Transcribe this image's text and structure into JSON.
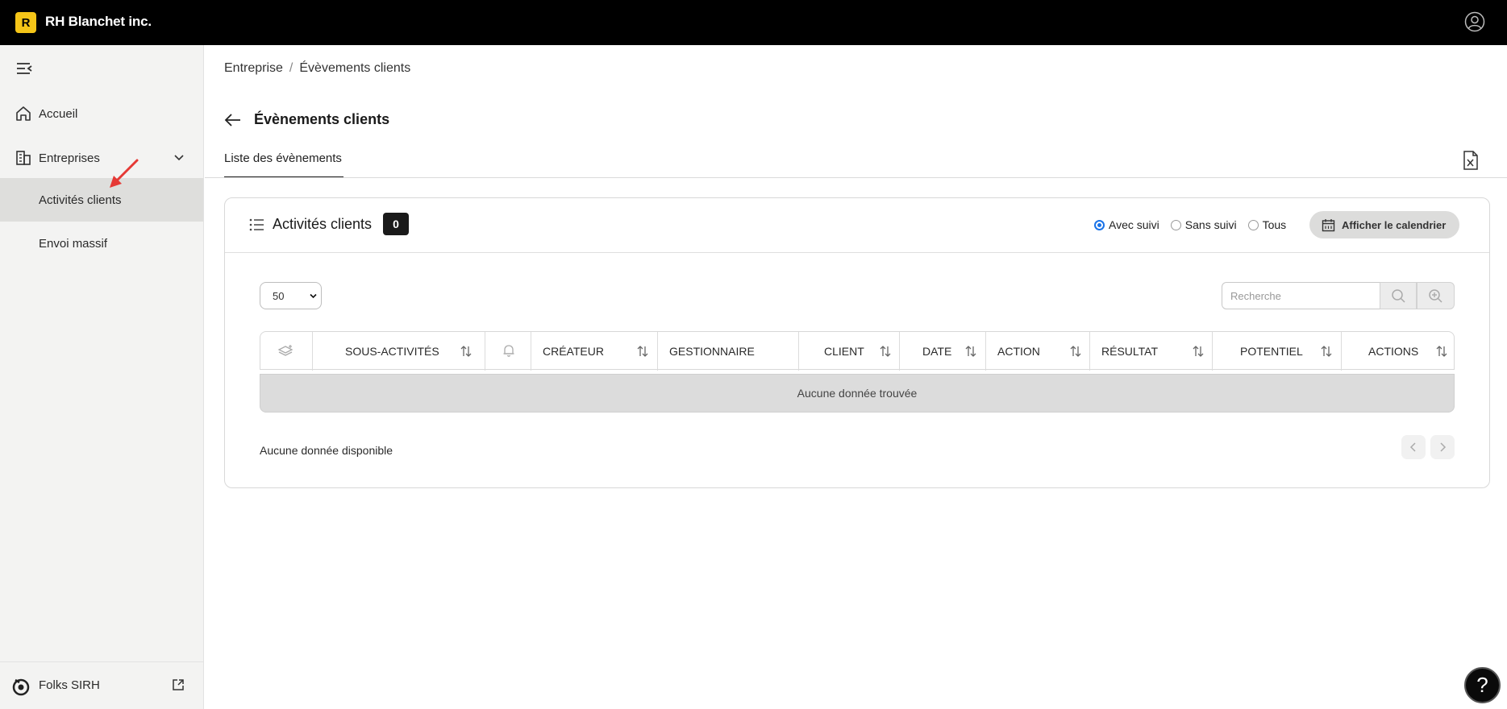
{
  "app": {
    "logo_letter": "R",
    "company_name": "RH Blanchet inc."
  },
  "sidebar": {
    "items": [
      {
        "label": "Accueil",
        "icon": "home-icon"
      },
      {
        "label": "Entreprises",
        "icon": "building-icon"
      }
    ],
    "sub_items": [
      {
        "label": "Activités clients",
        "active": true
      },
      {
        "label": "Envoi massif",
        "active": false
      }
    ],
    "footer": {
      "label": "Folks SIRH",
      "icon": "folks-logo-icon"
    }
  },
  "breadcrumb": {
    "parent": "Entreprise",
    "separator": "/",
    "current": "Évèvements clients"
  },
  "page": {
    "title": "Évènements clients",
    "tab_active": "Liste des évènements"
  },
  "card": {
    "title": "Activités clients",
    "count": "0",
    "filters": [
      {
        "label": "Avec suivi",
        "checked": true
      },
      {
        "label": "Sans suivi",
        "checked": false
      },
      {
        "label": "Tous",
        "checked": false
      }
    ],
    "calendar_button": "Afficher le calendrier",
    "page_size": "50",
    "search_placeholder": "Recherche",
    "columns": [
      "SOUS-ACTIVITÉS",
      "CRÉATEUR",
      "GESTIONNAIRE",
      "CLIENT",
      "DATE",
      "ACTION",
      "RÉSULTAT",
      "POTENTIEL",
      "ACTIONS"
    ],
    "empty_message": "Aucune donnée trouvée",
    "footer_message": "Aucune donnée disponible"
  },
  "help": {
    "label": "?"
  },
  "colors": {
    "topbar": "#000000",
    "logo_accent": "#f5c518",
    "radio_accent": "#1a73e8",
    "sidebar_bg": "#f3f3f2",
    "sidebar_active": "#dededc",
    "annotation_arrow": "#e53935"
  }
}
